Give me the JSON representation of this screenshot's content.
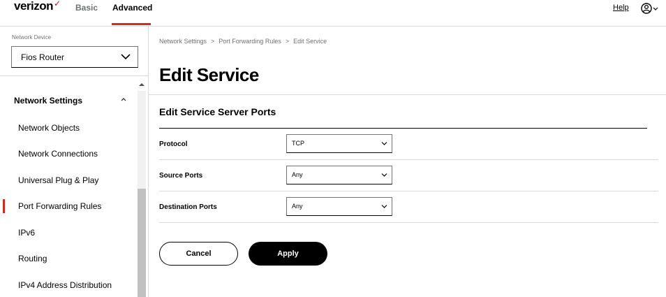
{
  "header": {
    "logo": "verizon",
    "logo_check": "✓",
    "tabs": [
      {
        "label": "Basic"
      },
      {
        "label": "Advanced"
      }
    ],
    "help_label": "Help",
    "accent_color": "#d52b1e"
  },
  "sidebar": {
    "device_label": "Network Device",
    "device_value": "Fios Router",
    "section_title": "Network Settings",
    "items": [
      {
        "label": "Network Objects"
      },
      {
        "label": "Network Connections"
      },
      {
        "label": "Universal Plug & Play"
      },
      {
        "label": "Port Forwarding Rules"
      },
      {
        "label": "IPv6"
      },
      {
        "label": "Routing"
      },
      {
        "label": "IPv4 Address Distribution"
      }
    ]
  },
  "breadcrumb": [
    "Network Settings",
    "Port Forwarding Rules",
    "Edit Service"
  ],
  "main": {
    "title": "Edit Service",
    "subtitle": "Edit Service Server Ports",
    "fields": [
      {
        "label": "Protocol",
        "value": "TCP"
      },
      {
        "label": "Source Ports",
        "value": "Any"
      },
      {
        "label": "Destination Ports",
        "value": "Any"
      }
    ],
    "cancel_label": "Cancel",
    "apply_label": "Apply"
  }
}
